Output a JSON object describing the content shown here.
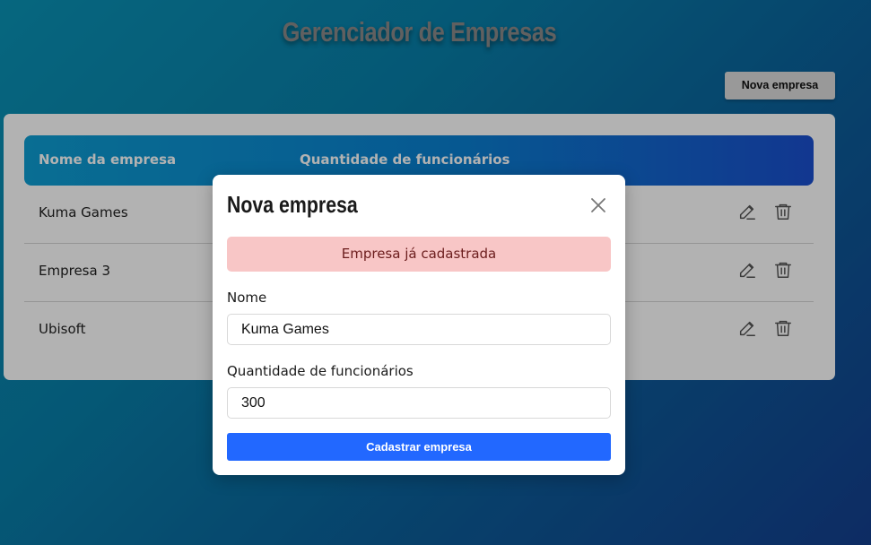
{
  "page": {
    "title": "Gerenciador de Empresas",
    "new_company_button": "Nova empresa"
  },
  "table": {
    "headers": [
      "Nome da empresa",
      "Quantidade de funcionários"
    ],
    "rows": [
      {
        "name": "Kuma Games"
      },
      {
        "name": "Empresa 3"
      },
      {
        "name": "Ubisoft"
      }
    ],
    "row_action_icons": [
      "pencil-icon",
      "trash-icon"
    ]
  },
  "modal": {
    "title": "Nova empresa",
    "close_icon": "close-icon",
    "alert": "Empresa já cadastrada",
    "fields": {
      "nome": {
        "label": "Nome",
        "value": "Kuma Games"
      },
      "quantidade": {
        "label": "Quantidade de funcionários",
        "value": "300"
      }
    },
    "submit_button": "Cadastrar empresa"
  },
  "colors": {
    "submit_button": "#2268ff",
    "alert_background": "#f8c6c6",
    "alert_text": "#6b1d1d",
    "header_gradient_start": "#0d9ed3",
    "header_gradient_end": "#1a4fcf"
  }
}
